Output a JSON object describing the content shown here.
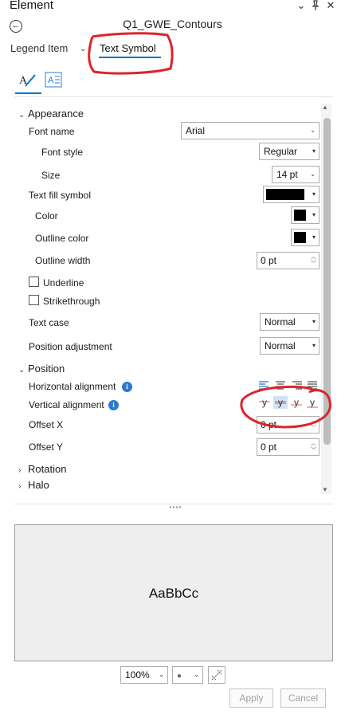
{
  "panel": {
    "title": "Element",
    "layer_name": "Q1_GWE_Contours",
    "icons": [
      "chevron-down-icon",
      "pin-icon",
      "close-icon",
      "back-arrow-icon"
    ]
  },
  "tabs": {
    "legend_item": "Legend Item",
    "text_symbol": "Text Symbol"
  },
  "appearance": {
    "header": "Appearance",
    "font_name_label": "Font name",
    "font_name_value": "Arial",
    "font_style_label": "Font style",
    "font_style_value": "Regular",
    "size_label": "Size",
    "size_value": "14 pt",
    "fill_symbol_label": "Text fill symbol",
    "color_label": "Color",
    "outline_color_label": "Outline color",
    "outline_width_label": "Outline width",
    "outline_width_value": "0 pt",
    "underline_label": "Underline",
    "strikethrough_label": "Strikethrough",
    "text_case_label": "Text case",
    "text_case_value": "Normal",
    "position_adjustment_label": "Position adjustment",
    "position_adjustment_value": "Normal",
    "fill_color": "#000000",
    "color_swatch": "#000000",
    "outline_swatch": "#000000"
  },
  "position": {
    "header": "Position",
    "horizontal_label": "Horizontal alignment",
    "vertical_label": "Vertical alignment",
    "offset_x_label": "Offset X",
    "offset_x_value": "0 pt",
    "offset_y_label": "Offset Y",
    "offset_y_value": "0 pt",
    "vertical_glyph": "y"
  },
  "collapsed_sections": {
    "rotation": "Rotation",
    "halo": "Halo"
  },
  "preview": {
    "sample_text": "AaBbCc",
    "zoom_value": "100%",
    "background_value": "●"
  },
  "buttons": {
    "apply": "Apply",
    "cancel": "Cancel"
  },
  "colors": {
    "accent": "#0a74c9",
    "annotation": "#e0232b",
    "info": "#2b79d0"
  }
}
